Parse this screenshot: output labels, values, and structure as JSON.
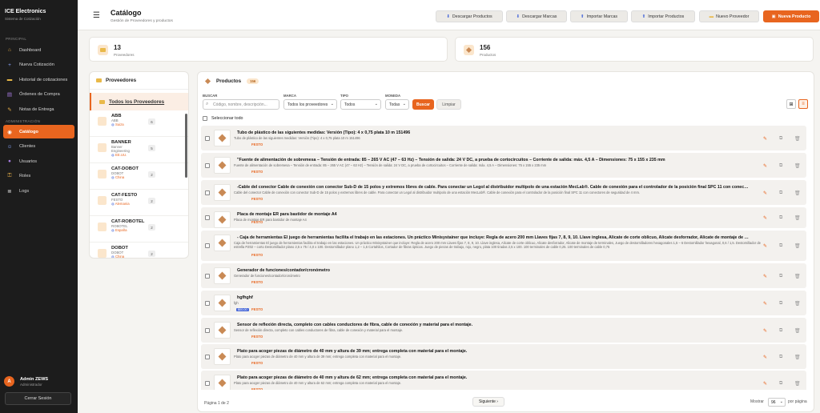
{
  "sidebar": {
    "brand_name": "ICE Electronics",
    "brand_sub": "Sistema de Cotización",
    "section_main": "Principal",
    "section_admin": "Administración",
    "items": [
      {
        "label": "Dashboard",
        "icon": "home-icon"
      },
      {
        "label": "Nueva Cotización",
        "icon": "plus-icon"
      },
      {
        "label": "Historial de cotizaciones",
        "icon": "folder-icon"
      },
      {
        "label": "Órdenes de Compra",
        "icon": "cart-icon"
      },
      {
        "label": "Notas de Entrega",
        "icon": "note-icon"
      }
    ],
    "admin_items": [
      {
        "label": "Catálogo",
        "icon": "catalog-icon",
        "active": true
      },
      {
        "label": "Clientes",
        "icon": "users-icon"
      },
      {
        "label": "Usuarios",
        "icon": "user-icon"
      },
      {
        "label": "Roles",
        "icon": "key-icon"
      },
      {
        "label": "Logs",
        "icon": "log-icon"
      }
    ],
    "user": {
      "initial": "A",
      "name": "Admin ZEWS",
      "role": "Administrador"
    },
    "logout": "Cerrar Sesión"
  },
  "header": {
    "title": "Catálogo",
    "subtitle": "Gestión de Proveedores y productos",
    "buttons": [
      "Descargar Productos",
      "Descargar Marcas",
      "Importar Marcas",
      "Importar Productos",
      "Nuevo Proveedor",
      "Nueva Producto"
    ]
  },
  "stats": [
    {
      "value": "13",
      "label": "Proveedores"
    },
    {
      "value": "156",
      "label": "Productos"
    }
  ],
  "providers": {
    "title": "Proveedores",
    "all_label": "Todos los Proveedores",
    "items": [
      {
        "name": "ABB",
        "sub1": "ABB",
        "sub2": "",
        "country": "Suiza",
        "count": "6"
      },
      {
        "name": "BANNER",
        "sub1": "Banner",
        "sub2": "Engineering",
        "country": "EE.UU.",
        "count": "5"
      },
      {
        "name": "CAT-DOBOT",
        "sub1": "DOBOT",
        "sub2": "",
        "country": "China",
        "count": "2"
      },
      {
        "name": "CAT-FESTO",
        "sub1": "FESTO",
        "sub2": "",
        "country": "Alemania",
        "count": "2"
      },
      {
        "name": "CAT-ROBOTEL",
        "sub1": "ROBOTEL",
        "sub2": "",
        "country": "España",
        "count": "2"
      },
      {
        "name": "DOBOT",
        "sub1": "DOBOT",
        "sub2": "",
        "country": "China",
        "count": "2"
      }
    ]
  },
  "products": {
    "title": "Productos",
    "count_badge": "156",
    "filters": {
      "search_label": "Buscar",
      "search_placeholder": "Código, nombre, descripción...",
      "brand_label": "Marca",
      "brand_value": "Todos los proveedores",
      "type_label": "Tipo",
      "type_value": "Todos",
      "currency_label": "Moneda",
      "currency_value": "Todas",
      "search_button": "Buscar",
      "clear_button": "Limpiar"
    },
    "select_all": "Seleccionar todo",
    "rows": [
      {
        "title": "Tubo de plástico de las siguientes medidas: Versión (Tipo): 4 x 0,75 plata 10 m 151496",
        "desc": "Tubo de plástico de las siguientes medidas: Versión (Tipo): 4 x 0,75 plata 10 m 151496",
        "brand": "FESTO",
        "tag": ""
      },
      {
        "title": "\"Fuente de alimentación de sobremesa – Tensión de entrada: 85 – 265 V AC (47 – 63 Hz) – Tensión de salida: 24 V DC, a prueba de cortocircuitos – Corriente de salida: máx. 4,5 A – Dimensiones: 75 x 155 x 235 mm",
        "desc": "Fuente de alimentación de sobremesa – Tensión de entrada: 85 – 265 V AC (47 – 63 Hz) – Tensión de salida: 24 V DC, a prueba de cortocircuitos – Corriente de salida: máx. 4,5 A – Dimensiones: 75 x 155 x 235 mm",
        "brand": "FESTO",
        "tag": ""
      },
      {
        "title": "-Cable del conector Cable de conexión con conector Sub-D de 15 polos y extremos libres de cable. Para conectar un Legol al distribuidor multipolo de una estación MecLab®. Cable de conexión para el controlador de la posición final SPC 11 con conectores d...",
        "desc": "Cable del conector Cable de conexión con conector Sub-D de 15 polos y extremos libres de cable. Para conectar un Legol al distribuidor multipolo de una estación MecLab®. Cable de conexión para el controlador de la posición final SPC 11 con conectores de seguridad de 4 mm.",
        "brand": "FESTO",
        "tag": ""
      },
      {
        "title": "Placa de montaje ER para bastidor de montaje A4",
        "desc": "Placa de montaje ER para bastidor de montaje A4",
        "brand": "FESTO",
        "tag": ""
      },
      {
        "title": "- Caja de herramientas El juego de herramientas facilita el trabajo en las estaciones. Un práctico Minisystainer que incluye: Regla de acero 200 mm Llaves fijas 7, 8, 9, 10. Llave inglesa, Alicate de corte oblicuo, Alicate desforrador, Alicate de montaje de ter...",
        "desc": "Caja de herramientas El juego de herramientas facilita el trabajo en las estaciones. Un práctico Minisystainer que incluye: Regla de acero 200 mm Llaves fijas 7, 8, 9, 10. Llave inglesa, Alicate de corte oblicuo, Alicate desforrador, Alicate de montaje de terminales, Juego de destornilladores hexagonales 1,5 – 6 Destornillador hexagonal, 0,6 / 1,5. Destornillador de estrella PZ02 – corto Destornillador plano 2,5 x 75 / 4,0 x 100. Destornillador plano 1,2 – 1,6 Cortahilos, Cortador de fibras ópticas. Juego de piezas de trabajo, rojo, negro, plata 100 tiradas 2,5 x 100. 100 terminales de cable 0,25. 100 terminales de cable 0,75",
        "brand": "FESTO",
        "tag": ""
      },
      {
        "title": "Generador de funciones/contador/cronómetro",
        "desc": "Generador de funciones/contador/cronómetro",
        "brand": "FESTO",
        "tag": ""
      },
      {
        "title": "hgfhghf",
        "desc": "fgh",
        "brand": "FESTO",
        "tag": "$00.00"
      },
      {
        "title": "Sensor de reflexión directa, completo con cables conductores de fibra, cable de conexión y material para el montaje.",
        "desc": "Sensor de reflexión directa, completo con cables conductores de fibra, cable de conexión y material para el montaje.",
        "brand": "FESTO",
        "tag": ""
      },
      {
        "title": "Plato para acoger piezas de diámetro de 40 mm y altura de 39 mm; entrega completa con material para el montaje.",
        "desc": "Plato para acoger piezas de diámetro de 40 mm y altura de 39 mm; entrega completa con material para el montaje.",
        "brand": "FESTO",
        "tag": ""
      },
      {
        "title": "Plato para acoger piezas de diámetro de 40 mm y altura de 62 mm; entrega completa con material para el montaje.",
        "desc": "Plato para acoger piezas de diámetro de 40 mm y altura de 62 mm; entrega completa con material para el montaje.",
        "brand": "FESTO",
        "tag": ""
      }
    ],
    "pager": {
      "info": "Página 1 de 2",
      "next": "Siguiente ›",
      "show_label": "Mostrar",
      "show_value": "96",
      "per_page": "por página"
    }
  },
  "colors": {
    "accent": "#e8651f",
    "sidebar_bg": "#1c1c1c"
  }
}
